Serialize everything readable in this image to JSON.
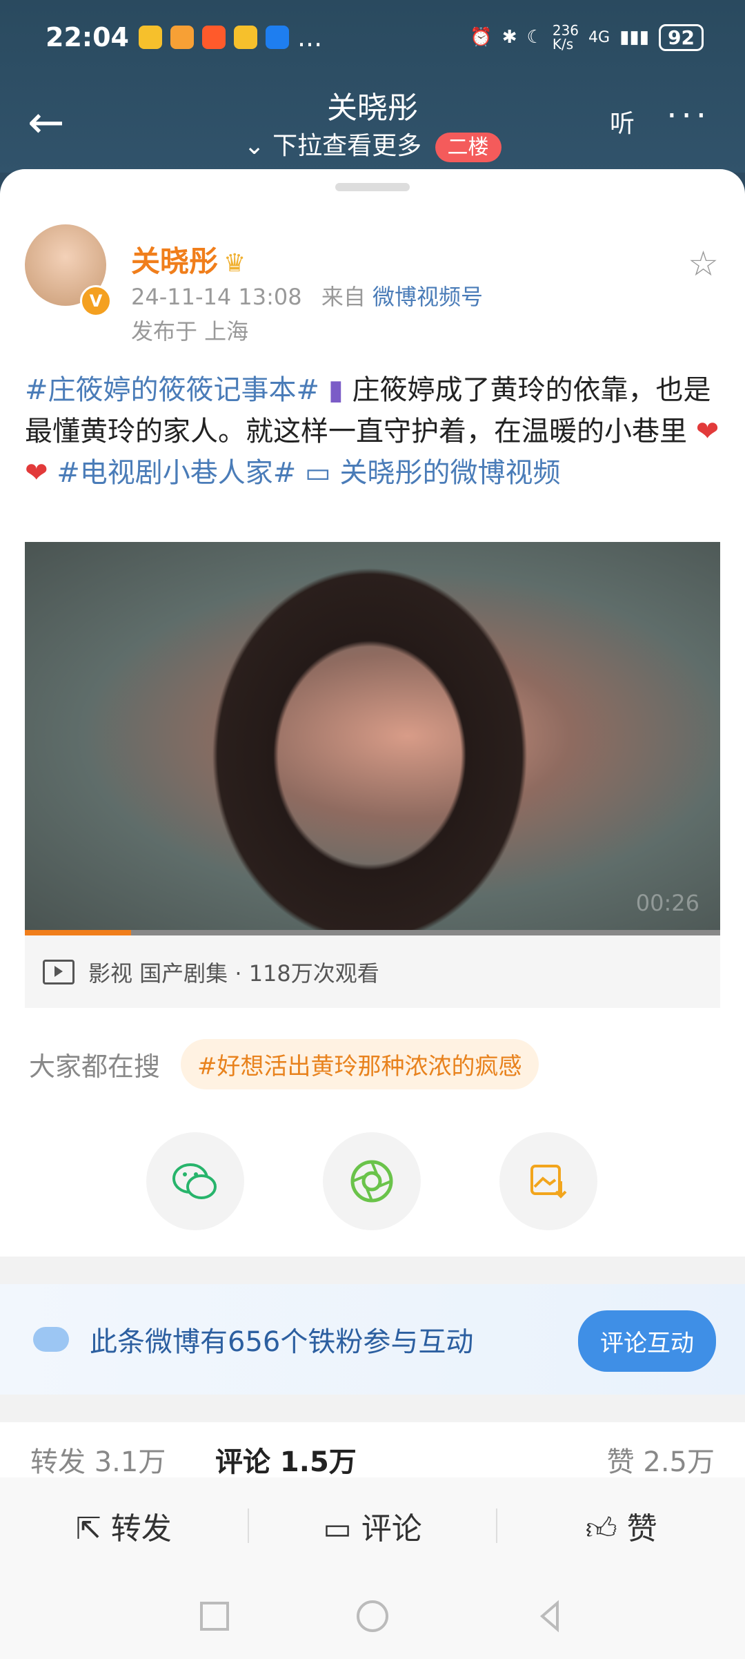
{
  "status": {
    "time": "22:04",
    "dots": "...",
    "speed": "236\nK/s",
    "network": "4G",
    "battery": "92"
  },
  "nav": {
    "title": "关晓彤",
    "subtitle": "下拉查看更多",
    "badge": "二楼",
    "listen": "听"
  },
  "post": {
    "author": "关晓彤",
    "datetime": "24-11-14 13:08",
    "from_label": "来自",
    "source": "微博视频号",
    "location": "发布于 上海",
    "text": {
      "tag1": "#庄筱婷的筱筱记事本#",
      "body": "庄筱婷成了黄玲的依靠，也是最懂黄玲的家人。就这样一直守护着，在温暖的小巷里",
      "hearts": "❤❤",
      "tag2": "#电视剧小巷人家#",
      "video_link": "关晓彤的微博视频"
    },
    "video": {
      "duration": "00:26",
      "progress": 0.153,
      "info": "影视 国产剧集 · 118万次观看"
    }
  },
  "search": {
    "label": "大家都在搜",
    "topic": "#好想活出黄玲那种浓浓的疯感"
  },
  "fans": {
    "text": "此条微博有656个铁粉参与互动",
    "button": "评论互动"
  },
  "counts": {
    "repost": "转发 3.1万",
    "comment": "评论 1.5万",
    "like": "赞 2.5万"
  },
  "actions": {
    "repost": "转发",
    "comment": "评论",
    "like": "赞"
  }
}
